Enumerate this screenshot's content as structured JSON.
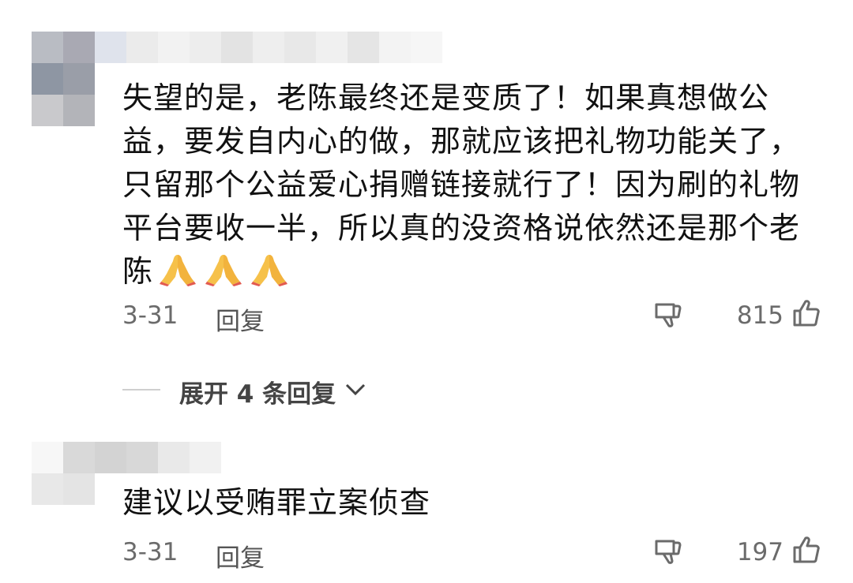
{
  "comments": [
    {
      "text": "失望的是，老陈最终还是变质了！如果真想做公益，要发自内心的做，那就应该把礼物功能关了，只留那个公益爱心捐赠链接就行了！因为刷的礼物平台要收一半，所以真的没资格说依然还是那个老陈",
      "emojis": [
        "🙏",
        "🙏",
        "🙏"
      ],
      "date": "3-31",
      "reply_label": "回复",
      "likes": "815",
      "expand_label": "展开 4 条回复"
    },
    {
      "text": "建议以受贿罪立案侦查",
      "date": "3-31",
      "reply_label": "回复",
      "likes": "197"
    }
  ],
  "icons": {
    "dislike": "thumbs-down-icon",
    "like": "thumbs-up-icon",
    "expand": "chevron-down-icon",
    "emoji": "folded-hands-emoji"
  }
}
